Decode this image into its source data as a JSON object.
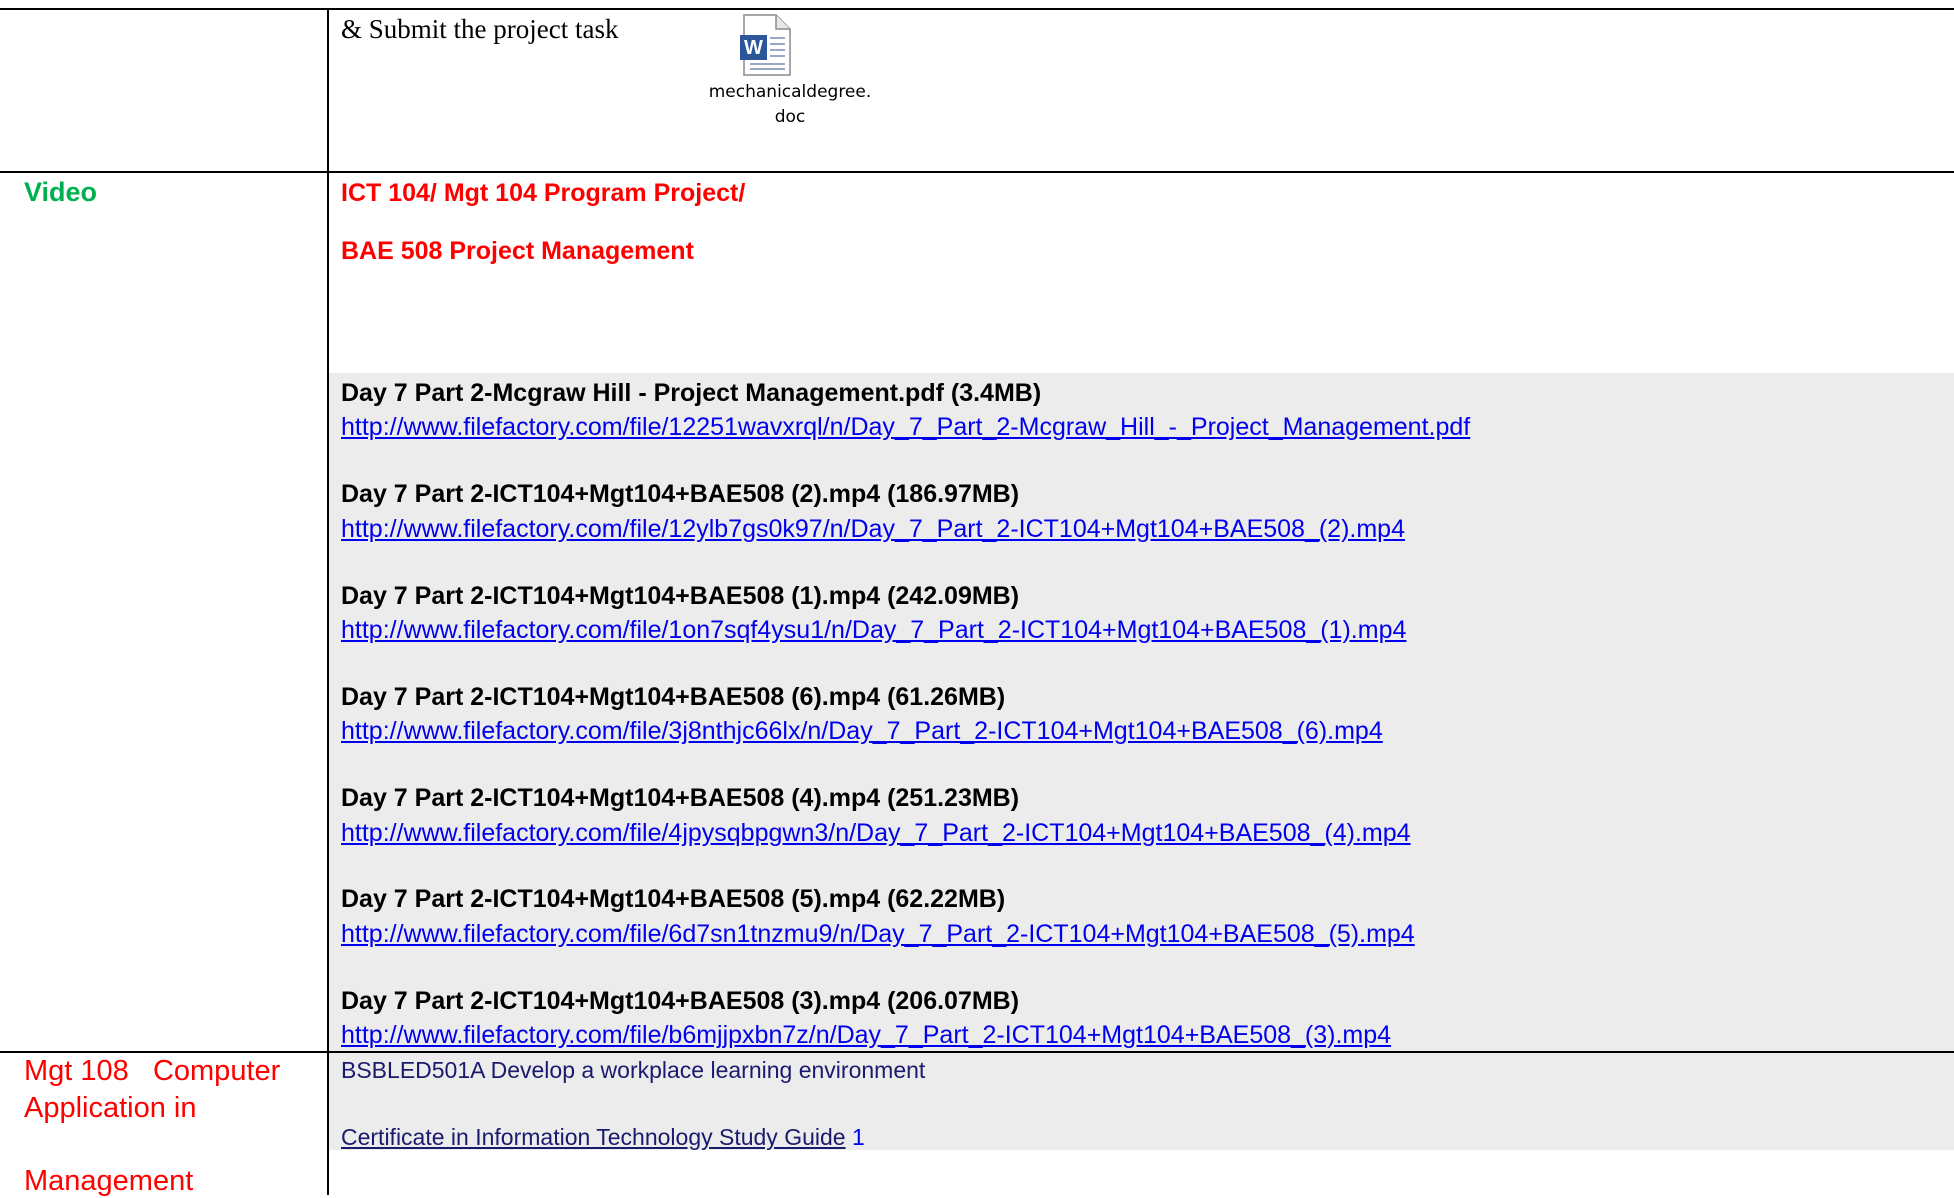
{
  "top_row": {
    "task_text": "& Submit the project task",
    "attachment": {
      "icon": "word-document-icon",
      "name_line1": "mechanicaldegree.",
      "name_line2": "doc"
    }
  },
  "video_row": {
    "label": "Video",
    "heading_line1": "ICT 104/ Mgt 104  Program Project/",
    "heading_line2": "BAE 508 Project Management",
    "entries": [
      {
        "title": "Day 7 Part 2-Mcgraw Hill - Project Management.pdf (3.4MB)",
        "link": "http://www.filefactory.com/file/12251wavxrql/n/Day_7_Part_2-Mcgraw_Hill_-_Project_Management.pdf"
      },
      {
        "title": "Day 7 Part 2-ICT104+Mgt104+BAE508 (2).mp4 (186.97MB)",
        "link": "http://www.filefactory.com/file/12ylb7gs0k97/n/Day_7_Part_2-ICT104+Mgt104+BAE508_(2).mp4"
      },
      {
        "title": "Day 7 Part 2-ICT104+Mgt104+BAE508 (1).mp4 (242.09MB)",
        "link": "http://www.filefactory.com/file/1on7sqf4ysu1/n/Day_7_Part_2-ICT104+Mgt104+BAE508_(1).mp4"
      },
      {
        "title": "Day 7 Part 2-ICT104+Mgt104+BAE508 (6).mp4 (61.26MB)",
        "link": "http://www.filefactory.com/file/3j8nthjc66lx/n/Day_7_Part_2-ICT104+Mgt104+BAE508_(6).mp4"
      },
      {
        "title": "Day 7 Part 2-ICT104+Mgt104+BAE508 (4).mp4 (251.23MB)",
        "link": "http://www.filefactory.com/file/4jpysqbpgwn3/n/Day_7_Part_2-ICT104+Mgt104+BAE508_(4).mp4"
      },
      {
        "title": "Day 7 Part 2-ICT104+Mgt104+BAE508 (5).mp4 (62.22MB)",
        "link": "http://www.filefactory.com/file/6d7sn1tnzmu9/n/Day_7_Part_2-ICT104+Mgt104+BAE508_(5).mp4"
      },
      {
        "title": "Day 7 Part 2-ICT104+Mgt104+BAE508 (3).mp4 (206.07MB)",
        "link": "http://www.filefactory.com/file/b6mjjpxbn7z/n/Day_7_Part_2-ICT104+Mgt104+BAE508_(3).mp4"
      }
    ]
  },
  "mgt_row": {
    "label_line1": "Mgt 108   Computer",
    "label_line2": "Application in",
    "label_line3": "Management",
    "course_text": "BSBLED501A Develop a workplace learning environment",
    "study_guide_link": "Certificate in Information Technology Study Guide",
    "study_guide_suffix": " 1"
  },
  "colors": {
    "label_green": "#00b050",
    "heading_red": "#ff0000",
    "link_blue": "#0000ee",
    "band_gray": "#ececec"
  }
}
